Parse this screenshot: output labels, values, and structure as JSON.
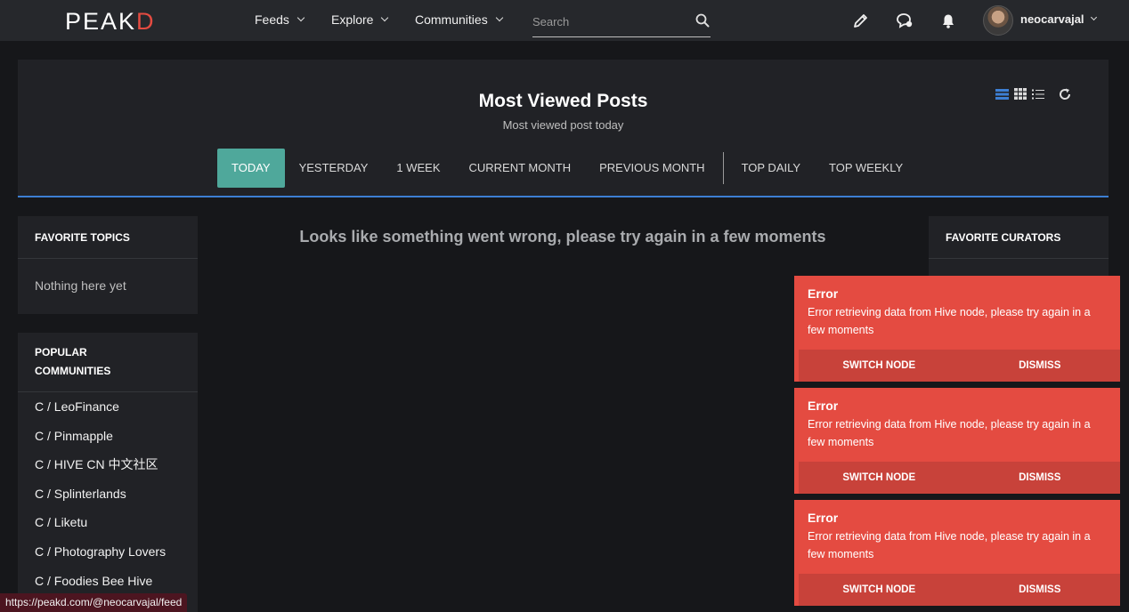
{
  "navbar": {
    "logo_text": "PEAK",
    "logo_accent": "D",
    "menus": [
      {
        "label": "Feeds"
      },
      {
        "label": "Explore"
      },
      {
        "label": "Communities"
      }
    ],
    "search": {
      "placeholder": "Search",
      "value": ""
    },
    "icons": [
      "pencil-icon",
      "chat-icon",
      "bell-icon"
    ],
    "username": "neocarvajal"
  },
  "header": {
    "title": "Most Viewed Posts",
    "subtitle": "Most viewed post today",
    "view_modes": [
      "list-view-icon",
      "grid-view-icon",
      "compact-view-icon"
    ],
    "tabs": [
      {
        "label": "TODAY",
        "active": true
      },
      {
        "label": "YESTERDAY"
      },
      {
        "label": "1 WEEK"
      },
      {
        "label": "CURRENT MONTH"
      },
      {
        "label": "PREVIOUS MONTH"
      },
      {
        "label": "TOP DAILY"
      },
      {
        "label": "TOP WEEKLY"
      }
    ]
  },
  "sidebar_left": {
    "favorite_topics": {
      "title": "FAVORITE TOPICS",
      "empty_text": "Nothing here yet"
    },
    "popular_communities": {
      "title_line1": "POPULAR",
      "title_line2": "COMMUNITIES",
      "items": [
        "C / LeoFinance",
        "C / Pinmapple",
        "C / HIVE CN 中文社区",
        "C / Splinterlands",
        "C / Liketu",
        "C / Photography Lovers",
        "C / Foodies Bee Hive"
      ]
    }
  },
  "sidebar_right": {
    "favorite_curators": {
      "title": "FAVORITE CURATORS"
    }
  },
  "main": {
    "error_message": "Looks like something went wrong, please try again in a few moments"
  },
  "toasts": [
    {
      "title": "Error",
      "text": "Error retrieving data from Hive node, please try again in a few moments",
      "switch_label": "SWITCH NODE",
      "dismiss_label": "DISMISS"
    },
    {
      "title": "Error",
      "text": "Error retrieving data from Hive node, please try again in a few moments",
      "switch_label": "SWITCH NODE",
      "dismiss_label": "DISMISS"
    },
    {
      "title": "Error",
      "text": "Error retrieving data from Hive node, please try again in a few moments",
      "switch_label": "SWITCH NODE",
      "dismiss_label": "DISMISS"
    }
  ],
  "status_bar": {
    "url": "https://peakd.com/@neocarvajal/feed"
  },
  "colors": {
    "accent": "#4fa89b",
    "error": "#e44b41",
    "link_blue": "#3d7fd3",
    "brand_red": "#e44b41"
  }
}
